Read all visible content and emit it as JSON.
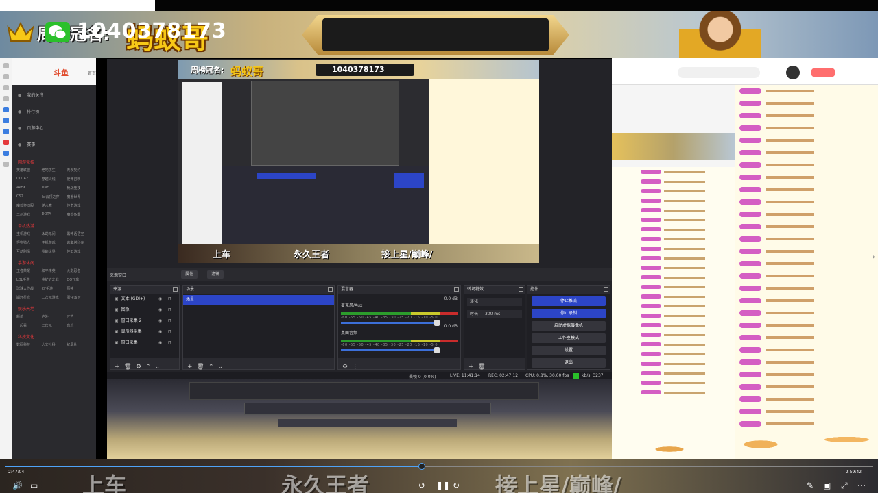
{
  "banner": {
    "sponsor_label": "周榜冠名:",
    "sponsor_name": "蚂蚁哥",
    "wechat_number": "1040378173"
  },
  "left_site": {
    "logo": "斗鱼",
    "home": "首页",
    "nav": [
      "我的关注",
      "排行榜",
      "页游中心",
      "赛事"
    ],
    "sections": [
      {
        "title": "网游竞技",
        "items": [
          "英雄联盟",
          "绝地求生",
          "无畏契约",
          "DOTA2",
          "穿越火线",
          "使命召唤",
          "APEX",
          "DNF",
          "枪战竞技",
          "CS2",
          "lol云顶之弈",
          "魔兽世界",
          "魔兽怀旧服",
          "逆水寒",
          "传奇游戏",
          "二创游戏",
          "DOTA",
          "魔兽争霸"
        ]
      },
      {
        "title": "单机热游",
        "items": [
          "主机游戏",
          "永劫无间",
          "黑神话悟空",
          "怪物猎人",
          "主机游戏",
          "逃离塔科夫",
          "互动剧情",
          "我的世界",
          "怀旧游戏"
        ]
      },
      {
        "title": "手游休闲",
        "items": [
          "王者荣耀",
          "和平精英",
          "火影忍者",
          "LOL手游",
          "金铲铲之战",
          "QQ飞车",
          "球球大作战",
          "CF手游",
          "原神",
          "崩坏星穹",
          "二次元游戏",
          "蛋仔派对"
        ]
      },
      {
        "title": "娱乐天地",
        "items": [
          "颜值",
          "户外",
          "才艺",
          "一起看",
          "二次元",
          "音乐"
        ]
      },
      {
        "title": "科技文化",
        "items": [
          "数码科技",
          "人文社科",
          "纪录片"
        ]
      }
    ]
  },
  "obs": {
    "toolbar": {
      "label": "来源窗口",
      "btn_props": "属性",
      "btn_filters": "滤镜"
    },
    "sources": {
      "title": "来源",
      "items": [
        "文本 (GDI+)",
        "图像",
        "窗口采集 2",
        "显示器采集",
        "窗口采集"
      ]
    },
    "scenes": {
      "title": "场景",
      "selected": "场景"
    },
    "mixer": {
      "title": "混音器",
      "channels": [
        {
          "name": "麦克风/Aux",
          "db": "0.0 dB"
        },
        {
          "name": "桌面音频",
          "db": "0.0 dB"
        }
      ],
      "ticks": "-60 -55 -50 -45 -40 -35 -30 -25 -20 -15 -10 -5 0"
    },
    "transitions": {
      "title": "转场特效",
      "type": "淡化",
      "duration_label": "时长",
      "duration": "300 ms"
    },
    "controls": {
      "title": "控件",
      "buttons": [
        "停止推流",
        "停止录制",
        "启动虚拟摄像机",
        "工作室模式",
        "设置",
        "退出"
      ]
    },
    "status": {
      "dropped": "丢帧 0 (0.0%)",
      "live": "LIVE: 11:41:14",
      "rec": "REC: 02:47:12",
      "cpu": "CPU: 0.8%, 30.00 fps",
      "kbps": "kb/s: 3237"
    }
  },
  "preview": {
    "sponsor_label": "周榜冠名:",
    "sponsor_name": "蚂蚁哥",
    "wechat_number": "1040378173",
    "bottom_texts": [
      "上车",
      "永久王者",
      "接上星/巅峰/"
    ]
  },
  "player": {
    "progress": 0.48,
    "current_time": "2:47:04",
    "total_time": "2:59:42",
    "overlay_texts": [
      "上车",
      "永久王者",
      "接上星/巅峰/"
    ]
  },
  "colors": {
    "obs_blue": "#2c45c7",
    "progress_blue": "#4fa3f7",
    "sponsor_gold": "#f7c817",
    "danmu_pink": "#d45ec3"
  }
}
